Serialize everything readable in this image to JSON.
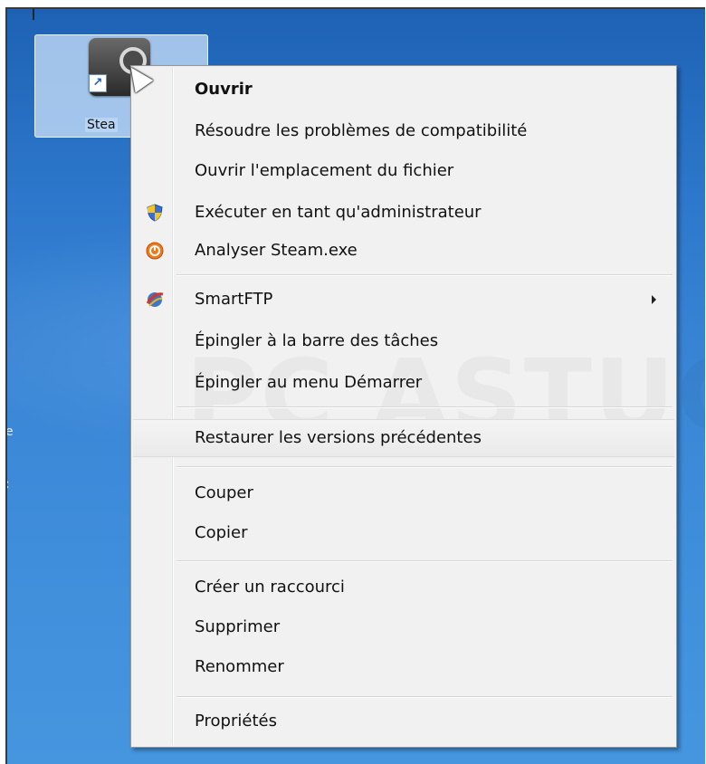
{
  "desktop": {
    "icon_label": "Stea",
    "fragments": [
      "e",
      ":"
    ]
  },
  "watermark": "PC ASTUCES",
  "menu": {
    "items": [
      {
        "label": "Ouvrir"
      },
      {
        "label": "Résoudre les problèmes de compatibilité"
      },
      {
        "label": "Ouvrir l'emplacement du fichier"
      },
      {
        "label": "Exécuter en tant qu'administrateur",
        "icon": "uac-shield-icon"
      },
      {
        "label": "Analyser Steam.exe",
        "icon": "antivirus-icon"
      },
      {
        "label": "SmartFTP",
        "icon": "smartftp-icon",
        "submenu": true
      },
      {
        "label": "Épingler à la barre des tâches"
      },
      {
        "label": "Épingler au menu Démarrer"
      },
      {
        "label": "Restaurer les versions précédentes"
      },
      {
        "label": "Couper"
      },
      {
        "label": "Copier"
      },
      {
        "label": "Créer un raccourci"
      },
      {
        "label": "Supprimer"
      },
      {
        "label": "Renommer"
      },
      {
        "label": "Propriétés"
      }
    ]
  },
  "colors": {
    "menu_bg": "#f1f1f1",
    "desktop_blue": "#3a86d6",
    "selection": "#cde1fa"
  }
}
